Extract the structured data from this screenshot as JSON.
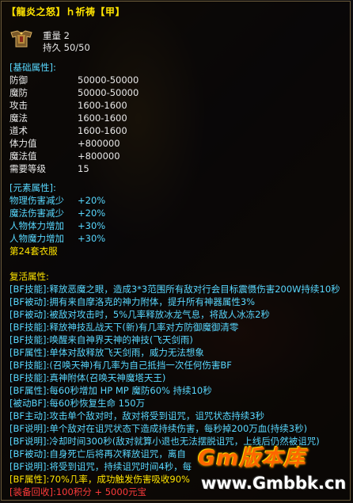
{
  "tooltip": {
    "title": "【龍炎之怒】ｈ祈祷【甲】",
    "weight": "重量 2",
    "durability": "持久 50/50",
    "base_header": "[基础属性]:",
    "base_stats": [
      {
        "label": "防御",
        "value": "50000-50000"
      },
      {
        "label": "魔防",
        "value": "50000-50000"
      },
      {
        "label": "攻击",
        "value": "1600-1600"
      },
      {
        "label": "魔法",
        "value": "1600-1600"
      },
      {
        "label": "道术",
        "value": "1600-1600"
      },
      {
        "label": "体力值",
        "value": "+800000"
      },
      {
        "label": "魔法值",
        "value": "+800000"
      },
      {
        "label": "需要等级",
        "value": "15"
      }
    ],
    "element_header": "[元素属性]:",
    "element_stats": [
      {
        "label": "物理伤害减少",
        "value": "+20%"
      },
      {
        "label": "魔法伤害减少",
        "value": "+20%"
      },
      {
        "label": "人物体力增加",
        "value": "+30%"
      },
      {
        "label": "人物魔力增加",
        "value": "+30%"
      }
    ],
    "set_name": "第24套衣服",
    "revive_header": "复活属性:",
    "skills": [
      "[BF技能]:释放恶魔之眼，造成3*3范围所有敌对行会目标震慑伤害200W持续10秒",
      "[BF被动]:拥有来自摩洛克的神力附体，提升所有神器属性3%",
      "[BF被动]:被敌对攻击时，5%几率释放冰龙气息，将敌人冰冻2秒",
      "[BF技能]:释放神技乱战天下(新)有几率对方防御魔御清零",
      "[BF技能]:唤醒来自神界天神的神技(飞天剑雨)",
      "[BF属性]:单体对敌释放飞天剑雨，威力无法想象",
      "[BF技能]:(召唤天神)有几率为自己抵挡一次任何伤害BF",
      "[BF技能]:真神附体(召唤天神魔塔天王)",
      "[BF属性]:每60秒增加 HP MP 魔防60% 持续10秒",
      "[被动BF]:每60秒恢复生命 150万",
      "[BF主动]:攻击单个敌对时，敌对将受到诅咒，诅咒状态持续3秒",
      "[BF说明]:单个敌对在诅咒状态下造成持续伤害，每秒掉200万血(持续3秒)",
      "[BF说明]:冷却时间300秒(敌对就算小退也无法摆脱诅咒，上线后仍然被诅咒)",
      "[BF被动]:自身死亡后将再次释放诅咒，离自",
      "[BF说明]:将受到诅咒，持续诅咒时间4秒，每",
      "[BF属性]:70%几率，成功触发伤害吸收90%"
    ],
    "recycle": "[装备回收]:100积分 + 5000元宝"
  },
  "watermark": {
    "logo": "Gm版本库",
    "url": "www.Gmbbk.cn"
  },
  "colors": {
    "title": "#ffe400",
    "text": "#e8e8e8",
    "skill": "#58d8ff",
    "recycle": "#ff3a3a",
    "border": "#6a5a3a"
  }
}
